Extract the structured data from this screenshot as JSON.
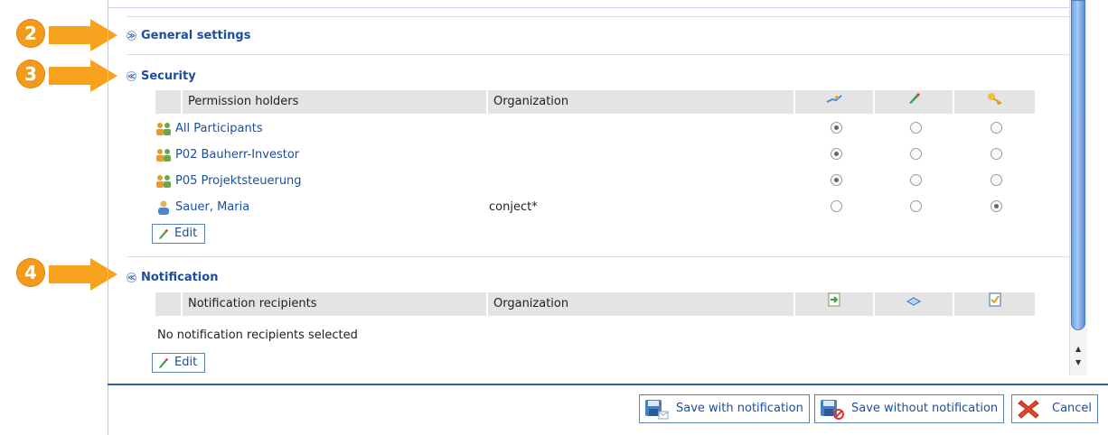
{
  "callouts": [
    {
      "number": "2"
    },
    {
      "number": "3"
    },
    {
      "number": "4"
    }
  ],
  "sections": {
    "general": {
      "title": "General settings",
      "collapsed": true
    },
    "security": {
      "title": "Security",
      "columns": {
        "holder": "Permission holders",
        "org": "Organization",
        "icons": [
          "link-icon",
          "pencil-icon",
          "key-icon"
        ]
      },
      "rows": [
        {
          "name": "All Participants",
          "org": "",
          "type": "group",
          "selected": 0
        },
        {
          "name": "P02 Bauherr-Investor",
          "org": "",
          "type": "group",
          "selected": 0
        },
        {
          "name": "P05 Projektsteuerung",
          "org": "",
          "type": "group",
          "selected": 0
        },
        {
          "name": "Sauer, Maria",
          "org": "conject*",
          "type": "user",
          "selected": 2
        }
      ],
      "edit_label": "Edit"
    },
    "notification": {
      "title": "Notification",
      "columns": {
        "recipient": "Notification recipients",
        "org": "Organization",
        "icons": [
          "document-arrow-icon",
          "book-icon",
          "checklist-icon"
        ]
      },
      "empty_text": "No notification recipients selected",
      "edit_label": "Edit"
    }
  },
  "footer": {
    "save_with": "Save with notification",
    "save_without": "Save without notification",
    "cancel": "Cancel"
  },
  "colors": {
    "accent": "#1a4e9e",
    "callout": "#f29a1a"
  }
}
